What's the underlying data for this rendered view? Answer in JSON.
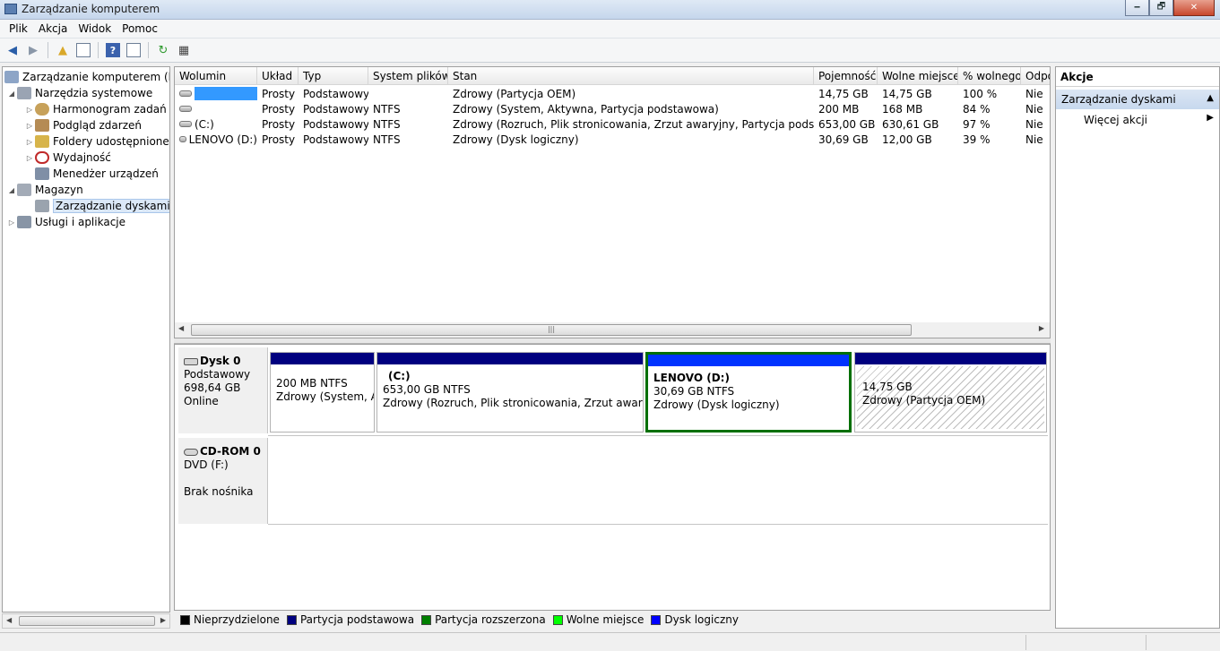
{
  "window": {
    "title": "Zarządzanie komputerem",
    "minimize": "🗕",
    "maximize": "🗗",
    "close": "✕"
  },
  "menu": [
    "Plik",
    "Akcja",
    "Widok",
    "Pomoc"
  ],
  "tree": {
    "root": "Zarządzanie komputerem (loka",
    "system_tools": "Narzędzia systemowe",
    "task_scheduler": "Harmonogram zadań",
    "event_viewer": "Podgląd zdarzeń",
    "shared_folders": "Foldery udostępnione",
    "performance": "Wydajność",
    "device_manager": "Menedżer urządzeń",
    "storage": "Magazyn",
    "disk_management": "Zarządzanie dyskami",
    "services": "Usługi i aplikacje"
  },
  "list": {
    "columns": [
      "Wolumin",
      "Układ",
      "Typ",
      "System plików",
      "Stan",
      "Pojemność",
      "Wolne miejsce",
      "% wolnego",
      "Odpo"
    ],
    "rows": [
      [
        "",
        "Prosty",
        "Podstawowy",
        "",
        "Zdrowy (Partycja OEM)",
        "14,75 GB",
        "14,75 GB",
        "100 %",
        "Nie"
      ],
      [
        "",
        "Prosty",
        "Podstawowy",
        "NTFS",
        "Zdrowy (System, Aktywna, Partycja podstawowa)",
        "200 MB",
        "168 MB",
        "84 %",
        "Nie"
      ],
      [
        "(C:)",
        "Prosty",
        "Podstawowy",
        "NTFS",
        "Zdrowy (Rozruch, Plik stronicowania, Zrzut awaryjny, Partycja podstawowa)",
        "653,00 GB",
        "630,61 GB",
        "97 %",
        "Nie"
      ],
      [
        "LENOVO (D:)",
        "Prosty",
        "Podstawowy",
        "NTFS",
        "Zdrowy (Dysk logiczny)",
        "30,69 GB",
        "12,00 GB",
        "39 %",
        "Nie"
      ]
    ]
  },
  "disk0": {
    "name": "Dysk 0",
    "type": "Podstawowy",
    "size": "698,64 GB",
    "status": "Online",
    "partitions": [
      {
        "title": "",
        "size": "200 MB NTFS",
        "status": "Zdrowy (System, Ak"
      },
      {
        "title": "(C:)",
        "size": "653,00 GB NTFS",
        "status": "Zdrowy (Rozruch, Plik stronicowania, Zrzut awaryjny, P"
      },
      {
        "title": "LENOVO  (D:)",
        "size": "30,69 GB NTFS",
        "status": "Zdrowy (Dysk logiczny)"
      },
      {
        "title": "",
        "size": "14,75 GB",
        "status": "Zdrowy (Partycja OEM)"
      }
    ]
  },
  "cdrom0": {
    "name": "CD-ROM 0",
    "type": "DVD (F:)",
    "status": "Brak nośnika"
  },
  "legend": [
    {
      "label": "Nieprzydzielone",
      "color": "#000000"
    },
    {
      "label": "Partycja podstawowa",
      "color": "#00007f"
    },
    {
      "label": "Partycja rozszerzona",
      "color": "#007f00"
    },
    {
      "label": "Wolne miejsce",
      "color": "#00ff00"
    },
    {
      "label": "Dysk logiczny",
      "color": "#0000ff"
    }
  ],
  "actions": {
    "header": "Akcje",
    "section": "Zarządzanie dyskami",
    "more": "Więcej akcji"
  }
}
